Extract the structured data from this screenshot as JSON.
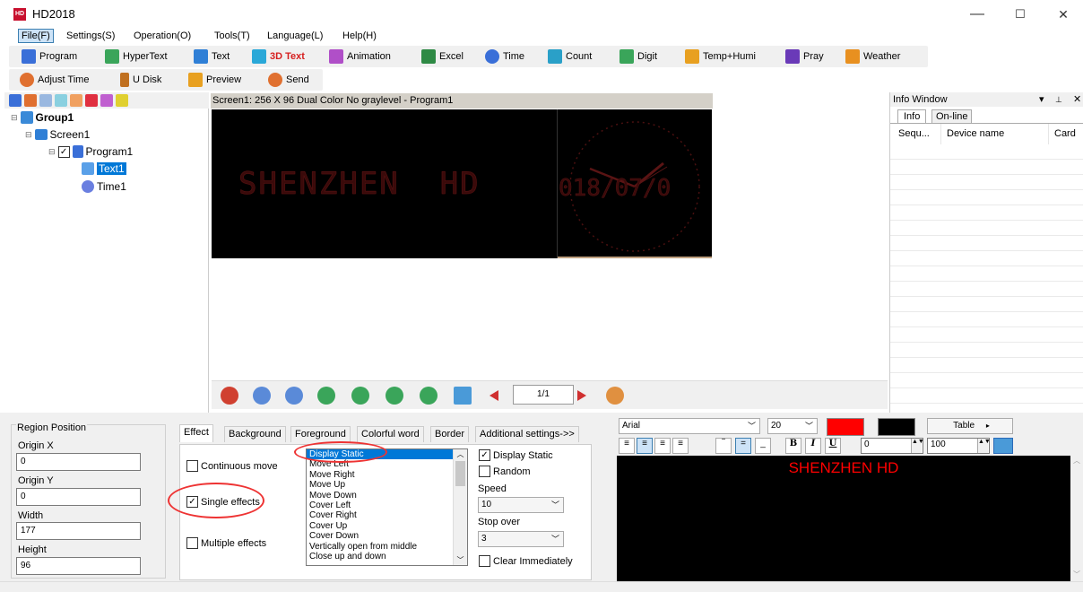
{
  "app": {
    "title": "HD2018"
  },
  "window_controls": {
    "minimize": "—",
    "maximize": "☐",
    "close": "✕"
  },
  "menu": [
    "File(F)",
    "Settings(S)",
    "Operation(O)",
    "Tools(T)",
    "Language(L)",
    "Help(H)"
  ],
  "toolbar1": [
    {
      "label": "Program",
      "icon": "program-icon",
      "color": "#3a6fd8"
    },
    {
      "label": "HyperText",
      "icon": "hypertext-icon",
      "color": "#3aa55a"
    },
    {
      "label": "Text",
      "icon": "text-icon",
      "color": "#2f7fd6"
    },
    {
      "label": "3D Text",
      "icon": "3d-text-icon",
      "color": "#2aa8d8",
      "text_color": "#d62020"
    },
    {
      "label": "Animation",
      "icon": "animation-icon",
      "color": "#b04fc8"
    },
    {
      "label": "Excel",
      "icon": "excel-icon",
      "color": "#2f8a45"
    },
    {
      "label": "Time",
      "icon": "time-icon",
      "color": "#3a6fd8"
    },
    {
      "label": "Count",
      "icon": "count-icon",
      "color": "#2aa0c8"
    },
    {
      "label": "Digit",
      "icon": "digit-icon",
      "color": "#3aa55a"
    },
    {
      "label": "Temp+Humi",
      "icon": "temp-humi-icon",
      "color": "#e8a020"
    },
    {
      "label": "Pray",
      "icon": "pray-icon",
      "color": "#6a3ab8"
    },
    {
      "label": "Weather",
      "icon": "weather-icon",
      "color": "#e89020"
    }
  ],
  "toolbar2": [
    {
      "label": "Adjust Time",
      "icon": "adjust-time-icon",
      "color": "#e07030"
    },
    {
      "label": "U Disk",
      "icon": "u-disk-icon",
      "color": "#c07020"
    },
    {
      "label": "Preview",
      "icon": "preview-icon",
      "color": "#e8a020"
    },
    {
      "label": "Send",
      "icon": "send-icon",
      "color": "#e07030"
    }
  ],
  "tree": {
    "group": "Group1",
    "screen": "Screen1",
    "program": "Program1",
    "text": "Text1",
    "time": "Time1"
  },
  "preview": {
    "header": "Screen1: 256 X 96  Dual Color No graylevel - Program1",
    "led_text": "SHENZHEN  HD",
    "clock_date": "018/07/0",
    "page": "1/1"
  },
  "info_window": {
    "title": "Info Window",
    "tabs": [
      "Info",
      "On-line"
    ],
    "columns": [
      "Sequ...",
      "Device name",
      "Card"
    ]
  },
  "region": {
    "title": "Region Position",
    "origin_x_label": "Origin X",
    "origin_x": "0",
    "origin_y_label": "Origin Y",
    "origin_y": "0",
    "width_label": "Width",
    "width": "177",
    "height_label": "Height",
    "height": "96"
  },
  "effect_tabs": [
    "Effect",
    "Background",
    "Foreground",
    "Colorful word",
    "Border",
    "Additional settings->>"
  ],
  "effect": {
    "continuous_move": "Continuous move",
    "single_effects": "Single effects",
    "multiple_effects": "Multiple effects",
    "effects_list": [
      "Display Static",
      "Move Left",
      "Move Right",
      "Move Up",
      "Move Down",
      "Cover Left",
      "Cover Right",
      "Cover Up",
      "Cover Down",
      "Vertically open from middle",
      "Close up and down"
    ],
    "display_static": "Display Static",
    "random": "Random",
    "speed_label": "Speed",
    "speed": "10",
    "stop_over_label": "Stop over",
    "stop_over": "3",
    "clear_immediately": "Clear Immediately"
  },
  "editor": {
    "font": "Arial",
    "size": "20",
    "table_label": "Table",
    "spacing": "0",
    "scale": "100",
    "text": "SHENZHEN  HD",
    "text_color": "#ff0000",
    "bg_color": "#000000"
  }
}
